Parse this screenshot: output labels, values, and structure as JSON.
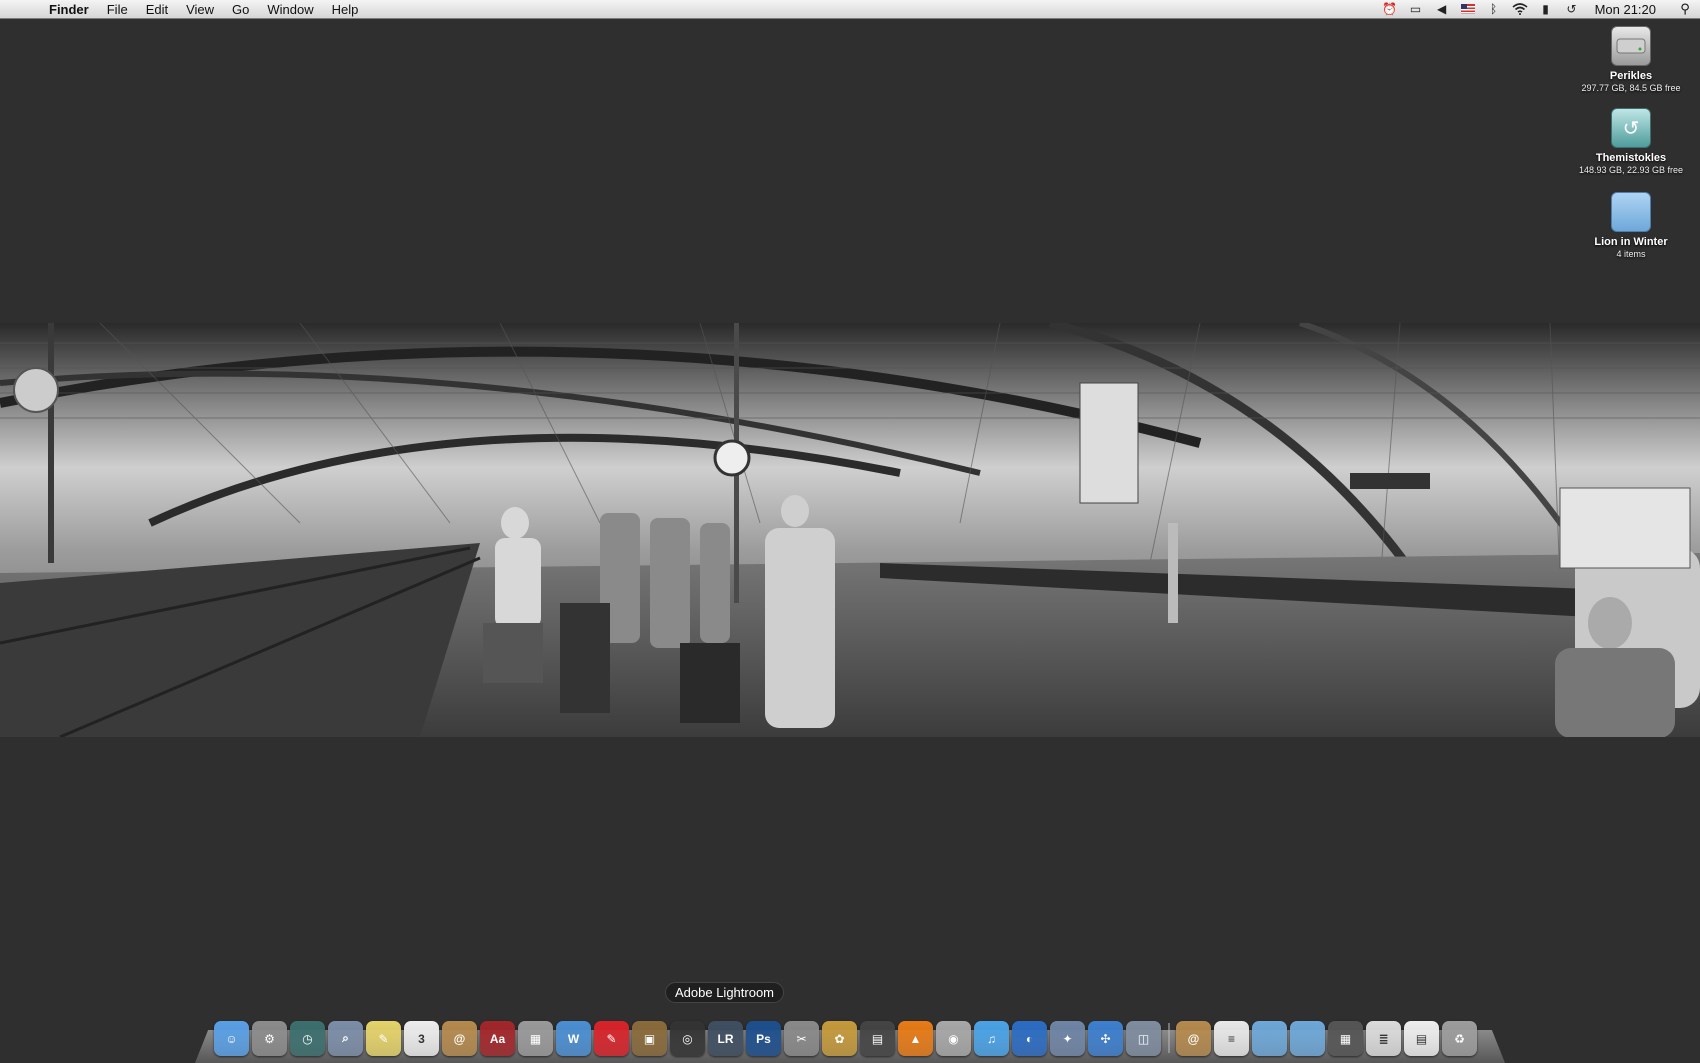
{
  "menubar": {
    "app_name": "Finder",
    "items": [
      "File",
      "Edit",
      "View",
      "Go",
      "Window",
      "Help"
    ],
    "status_icons": [
      "alarm-icon",
      "display-icon",
      "volume-icon",
      "flag-us-icon",
      "bluetooth-icon",
      "wifi-icon",
      "menu-extra-icon",
      "time-machine-icon"
    ],
    "clock": "Mon 21:20"
  },
  "desktop": {
    "icons": [
      {
        "name": "Perikles",
        "info": "297.77 GB, 84.5 GB free",
        "icon": "hard-drive-icon"
      },
      {
        "name": "Themistokles",
        "info": "148.93 GB, 22.93 GB free",
        "icon": "time-machine-drive-icon"
      },
      {
        "name": "Lion in Winter",
        "info": "4 items",
        "icon": "folder-icon"
      }
    ]
  },
  "wallpaper": {
    "description_icon": "train-station-photo"
  },
  "dock": {
    "tooltip": "Adobe Lightroom",
    "apps": [
      {
        "icon": "finder-icon",
        "color": "#5aa0e6",
        "glyph": "☺"
      },
      {
        "icon": "system-preferences-icon",
        "color": "#8c8c8c",
        "glyph": "⚙"
      },
      {
        "icon": "time-machine-icon",
        "color": "#3c6f6f",
        "glyph": "◷"
      },
      {
        "icon": "preview-icon",
        "color": "#7c8ea8",
        "glyph": "⌕"
      },
      {
        "icon": "stickies-icon",
        "color": "#e6d36a",
        "glyph": "✎"
      },
      {
        "icon": "ical-icon",
        "color": "#eeeeee",
        "glyph": "3"
      },
      {
        "icon": "address-book-icon",
        "color": "#b58a4e",
        "glyph": "@"
      },
      {
        "icon": "dictionary-icon",
        "color": "#a3262a",
        "glyph": "Aa"
      },
      {
        "icon": "calculator-icon",
        "color": "#9a9a9a",
        "glyph": "▦"
      },
      {
        "icon": "pages-icon",
        "color": "#4b8fd3",
        "glyph": "W"
      },
      {
        "icon": "acrobat-icon",
        "color": "#d8232a",
        "glyph": "✎"
      },
      {
        "icon": "iphoto-icon",
        "color": "#8a6a3a",
        "glyph": "▣"
      },
      {
        "icon": "aperture-icon",
        "color": "#333333",
        "glyph": "◎"
      },
      {
        "icon": "lightroom-icon",
        "color": "#3f4e61",
        "glyph": "LR"
      },
      {
        "icon": "photoshop-icon",
        "color": "#1d4f8e",
        "glyph": "Ps"
      },
      {
        "icon": "script-editor-icon",
        "color": "#8a8a8a",
        "glyph": "✂"
      },
      {
        "icon": "cider-icon",
        "color": "#c69a3c",
        "glyph": "✿"
      },
      {
        "icon": "final-cut-icon",
        "color": "#444444",
        "glyph": "▤"
      },
      {
        "icon": "vlc-icon",
        "color": "#e87b16",
        "glyph": "▲"
      },
      {
        "icon": "dvd-player-icon",
        "color": "#a8a8a8",
        "glyph": "◉"
      },
      {
        "icon": "itunes-icon",
        "color": "#4aa3e8",
        "glyph": "♫"
      },
      {
        "icon": "firefox-icon",
        "color": "#2b6cc4",
        "glyph": "◐"
      },
      {
        "icon": "xcode-icon",
        "color": "#6f85a6",
        "glyph": "✦"
      },
      {
        "icon": "safari-icon",
        "color": "#3d7fcf",
        "glyph": "✣"
      },
      {
        "icon": "image-capture-icon",
        "color": "#7f8da0",
        "glyph": "◫"
      }
    ],
    "stacks": [
      {
        "icon": "address-stack-icon",
        "color": "#b58a4e",
        "glyph": "@"
      },
      {
        "icon": "document-stack-icon",
        "color": "#e9e9e9",
        "glyph": "≡"
      },
      {
        "icon": "folder-stack-icon",
        "color": "#6ea8d9",
        "glyph": ""
      },
      {
        "icon": "folder-stack-2-icon",
        "color": "#6ea8d9",
        "glyph": ""
      },
      {
        "icon": "downloads-stack-icon",
        "color": "#555555",
        "glyph": "▦"
      },
      {
        "icon": "documents-stack-icon",
        "color": "#dcdcdc",
        "glyph": "≣"
      },
      {
        "icon": "spreadsheet-stack-icon",
        "color": "#efefef",
        "glyph": "▤"
      },
      {
        "icon": "trash-icon",
        "color": "#9d9d9d",
        "glyph": "♻"
      }
    ]
  }
}
